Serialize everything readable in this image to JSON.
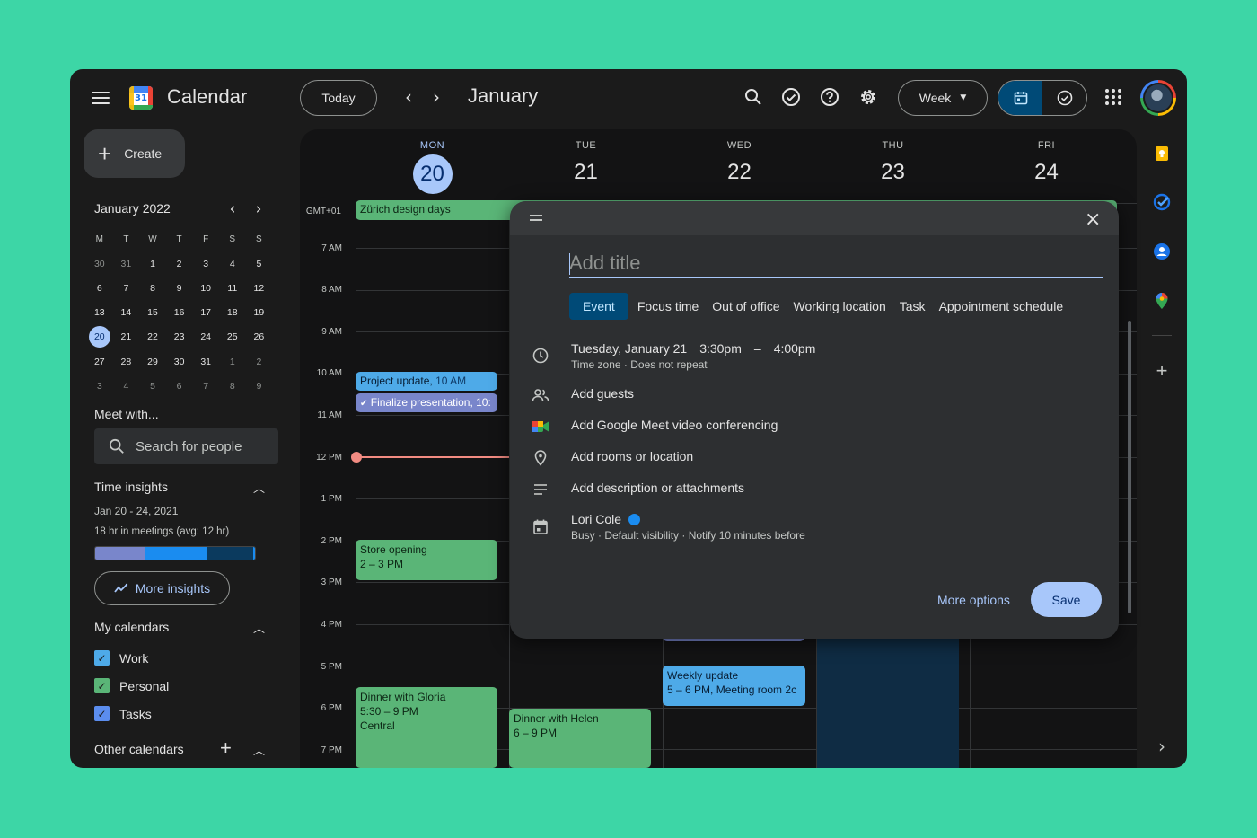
{
  "app": {
    "title": "Calendar",
    "logo_number": "31"
  },
  "toolbar": {
    "today_label": "Today",
    "month_label": "January",
    "view_label": "Week",
    "prev_icon": "chevron-left-icon",
    "next_icon": "chevron-right-icon"
  },
  "sidebar": {
    "create_label": "Create",
    "mini_calendar": {
      "title": "January 2022",
      "weekdays": [
        "M",
        "T",
        "W",
        "T",
        "F",
        "S",
        "S"
      ],
      "weeks": [
        [
          "30",
          "31",
          "1",
          "2",
          "3",
          "4",
          "5"
        ],
        [
          "6",
          "7",
          "8",
          "9",
          "10",
          "11",
          "12"
        ],
        [
          "13",
          "14",
          "15",
          "16",
          "17",
          "18",
          "19"
        ],
        [
          "20",
          "21",
          "22",
          "23",
          "24",
          "25",
          "26"
        ],
        [
          "27",
          "28",
          "29",
          "30",
          "31",
          "1",
          "2"
        ],
        [
          "3",
          "4",
          "5",
          "6",
          "7",
          "8",
          "9"
        ]
      ],
      "selected": "20"
    },
    "meet_with": "Meet with...",
    "search_people_placeholder": "Search for people",
    "time_insights": {
      "title": "Time insights",
      "range": "Jan 20 - 24, 2021",
      "summary": "18 hr in meetings (avg: 12 hr)",
      "more_label": "More insights"
    },
    "my_calendars": {
      "title": "My calendars",
      "items": [
        {
          "label": "Work",
          "color": "#4eaae8"
        },
        {
          "label": "Personal",
          "color": "#5ab577"
        },
        {
          "label": "Tasks",
          "color": "#5b8dee"
        }
      ]
    },
    "other_calendars": "Other calendars"
  },
  "grid": {
    "timezone": "GMT+01",
    "days": [
      {
        "name": "MON",
        "date": "20",
        "today": true
      },
      {
        "name": "TUE",
        "date": "21"
      },
      {
        "name": "WED",
        "date": "22"
      },
      {
        "name": "THU",
        "date": "23"
      },
      {
        "name": "FRI",
        "date": "24"
      }
    ],
    "hours": [
      "7 AM",
      "8 AM",
      "9 AM",
      "10 AM",
      "11 AM",
      "12 PM",
      "1 PM",
      "2 PM",
      "3 PM",
      "4 PM",
      "5 PM",
      "6 PM",
      "7 PM"
    ],
    "events": {
      "zurich": {
        "title": "Zürich design days"
      },
      "project_update": {
        "title": "Project update,",
        "time": "10 AM"
      },
      "finalize": {
        "title": "Finalize presentation, 10:"
      },
      "store_opening": {
        "title": "Store opening",
        "time": "2 – 3 PM"
      },
      "weekly_update": {
        "title": "Weekly update",
        "time": "5 – 6 PM, Meeting room 2c"
      },
      "dinner_gloria": {
        "title": "Dinner with Gloria",
        "time": "5:30 – 9 PM",
        "location": "Central"
      },
      "dinner_helen": {
        "title": "Dinner with Helen",
        "time": "6 – 9 PM"
      }
    }
  },
  "dialog": {
    "title_placeholder": "Add title",
    "tabs": [
      "Event",
      "Focus time",
      "Out of office",
      "Working location",
      "Task",
      "Appointment schedule"
    ],
    "datetime": {
      "date": "Tuesday, January 21",
      "start": "3:30pm",
      "sep": "–",
      "end": "4:00pm",
      "sub": "Time zone · Does not repeat"
    },
    "add_guests": "Add guests",
    "add_meet": "Add Google Meet video conferencing",
    "add_location": "Add rooms or location",
    "add_description": "Add description or attachments",
    "calendar": {
      "owner": "Lori Cole",
      "color": "#1a8cf0",
      "sub": "Busy · Default visibility · Notify 10 minutes before"
    },
    "more_options": "More options",
    "save": "Save"
  }
}
